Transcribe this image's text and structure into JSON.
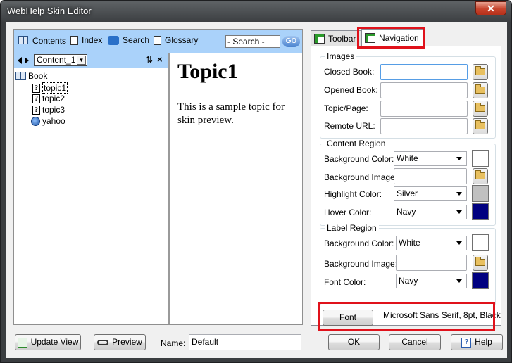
{
  "window": {
    "title": "WebHelp Skin Editor",
    "close_glyph": "✕"
  },
  "preview": {
    "toolbar": {
      "contents": "Contents",
      "index": "Index",
      "search": "Search",
      "glossary": "Glossary",
      "search_placeholder": "- Search -",
      "go": "GO"
    },
    "toc": {
      "selected_chm": "Content_1",
      "tree": {
        "book": "Book",
        "items": [
          "topic1",
          "topic2",
          "topic3"
        ],
        "remote": "yahoo"
      }
    },
    "topic": {
      "title": "Topic1",
      "body": "This is a sample topic for skin preview."
    }
  },
  "tabs": {
    "toolbar": "Toolbar",
    "navigation": "Navigation",
    "active": "Navigation"
  },
  "images": {
    "group_title": "Images",
    "closed_book": "Closed Book:",
    "opened_book": "Opened Book:",
    "topic_page": "Topic/Page:",
    "remote_url": "Remote URL:"
  },
  "content_region": {
    "group_title": "Content Region",
    "bg_color_label": "Background Color:",
    "bg_color_value": "White",
    "bg_image_label": "Background Image:",
    "highlight_label": "Highlight Color:",
    "highlight_value": "Silver",
    "hover_label": "Hover Color:",
    "hover_value": "Navy"
  },
  "label_region": {
    "group_title": "Label Region",
    "bg_color_label": "Background Color:",
    "bg_color_value": "White",
    "bg_image_label": "Background Image:",
    "font_color_label": "Font Color:",
    "font_color_value": "Navy"
  },
  "font": {
    "button": "Font",
    "description": "Microsoft Sans Serif, 8pt, Black"
  },
  "footer": {
    "update_view": "Update View",
    "preview": "Preview",
    "name_label": "Name:",
    "name_value": "Default",
    "ok": "OK",
    "cancel": "Cancel",
    "help": "Help"
  },
  "colors": {
    "white": "#ffffff",
    "silver": "#c0c0c0",
    "navy": "#000080",
    "highlight_red": "#e0121b",
    "nav_blue": "#aad2fa"
  }
}
